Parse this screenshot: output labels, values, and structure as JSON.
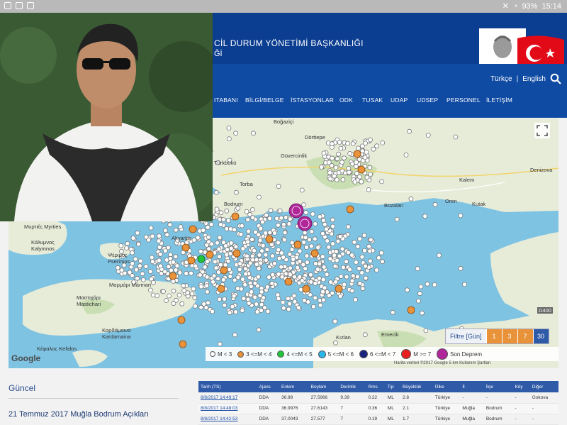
{
  "status_bar": {
    "battery": "93%",
    "time": "15:14"
  },
  "header": {
    "title": "CİL DURUM YÖNETİMİ BAŞKANLIĞI",
    "title2": "Ğİ"
  },
  "lang": {
    "tr": "Türkçe",
    "sep": "|",
    "en": "English"
  },
  "menu": [
    {
      "label": "ITABANI"
    },
    {
      "label": "BİLGİ/BELGE"
    },
    {
      "label": "İSTASYONLAR"
    },
    {
      "label": "ODK"
    },
    {
      "label": "TUSAK"
    },
    {
      "label": "UDAP"
    },
    {
      "label": "UDSEP"
    },
    {
      "label": "PERSONEL"
    },
    {
      "label": "İLETİŞİM"
    }
  ],
  "map_places": [
    {
      "name": "Boğaziçi"
    },
    {
      "name": "Dörttepe"
    },
    {
      "name": "Güvercinlik"
    },
    {
      "name": "Türkbükü"
    },
    {
      "name": "Torba"
    },
    {
      "name": "Bodrum"
    },
    {
      "name": "Kalem"
    },
    {
      "name": "Oren"
    },
    {
      "name": "Kutak"
    },
    {
      "name": "Bozalan"
    },
    {
      "name": "Denizova"
    },
    {
      "name": "Μυρτιές Myrties"
    },
    {
      "name": "Κάλυμνος Kalymnos"
    },
    {
      "name": "Ψέριμος Pserimos"
    },
    {
      "name": "Akyarlar"
    },
    {
      "name": "Μαστιχάρι Mastichari"
    },
    {
      "name": "Μαρμάρι Marmari"
    },
    {
      "name": "Καρδάμαινα Kardamaina"
    },
    {
      "name": "Κέφαλος Kefalos"
    },
    {
      "name": "Kızlan"
    },
    {
      "name": "Emecik"
    },
    {
      "name": "D400"
    }
  ],
  "filter": {
    "label": "Filtre [Gün]",
    "buttons": [
      "1",
      "3",
      "7",
      "30"
    ],
    "colors": [
      "#e8923a",
      "#e8923a",
      "#e8923a",
      "#2e5aa8"
    ]
  },
  "legend": [
    {
      "label": "M <   3",
      "color": "#ffffff"
    },
    {
      "label": "3 <=M < 4",
      "color": "#e8923a"
    },
    {
      "label": "4 <=M < 5",
      "color": "#21c43a"
    },
    {
      "label": "5 <=M < 6",
      "color": "#2ab6e8"
    },
    {
      "label": "6 <=M < 7",
      "color": "#1a237e"
    },
    {
      "label": "M >= 7",
      "color": "#e82020"
    },
    {
      "label": "Son Deprem",
      "color": "#b0279a"
    }
  ],
  "google_logo": "Google",
  "map_attribution": "Harita verileri ©2017 Google    5 km    Kullanım Şartları",
  "section": {
    "title": "Güncel",
    "news": "21 Temmuz 2017 Muğla Bodrum Açıkları"
  },
  "table": {
    "headers": [
      "Tarih (TS)",
      "Ajans",
      "Enlem",
      "Boylam",
      "Derinlik",
      "Rms",
      "Tip",
      "Büyüklük",
      "Ülke",
      "İl",
      "İlçe",
      "Köy",
      "Diğer"
    ],
    "rows": [
      [
        "8/8/2017 14:49:17",
        "DDA",
        "36.98",
        "27.5966",
        "9.39",
        "0.22",
        "ML",
        "2.8",
        "Türkiye",
        "-",
        "-",
        "-",
        "Gokova"
      ],
      [
        "8/8/2017 14:48:03",
        "DDA",
        "36.9976",
        "27.6143",
        "7",
        "0.36",
        "ML",
        "2.1",
        "Türkiye",
        "Muğla",
        "Bodrum",
        "-",
        "-"
      ],
      [
        "8/8/2017 14:42:53",
        "DDA",
        "37.0043",
        "27.577",
        "7",
        "0.19",
        "ML",
        "1.7",
        "Türkiye",
        "Muğla",
        "Bodrum",
        "-",
        "-"
      ]
    ]
  }
}
